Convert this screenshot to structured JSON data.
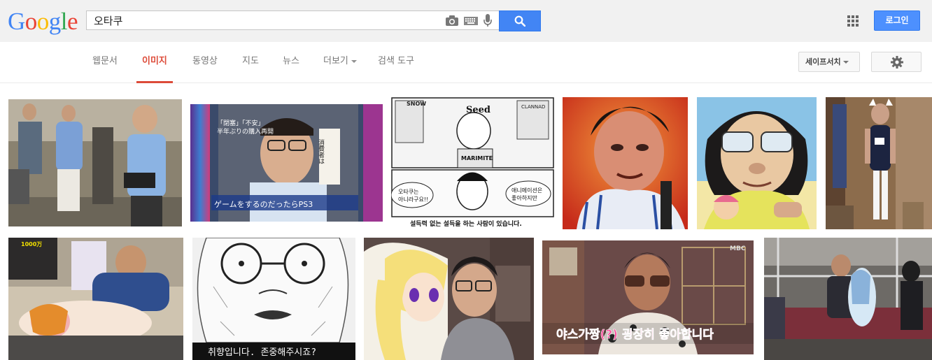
{
  "logo": [
    "G",
    "o",
    "o",
    "g",
    "l",
    "e"
  ],
  "logo_colors": [
    "#4285f4",
    "#ea4335",
    "#fbbc05",
    "#4285f4",
    "#34a853",
    "#ea4335"
  ],
  "search": {
    "value": "오타쿠"
  },
  "login_label": "로그인",
  "tabs": [
    {
      "label": "웹문서",
      "active": false
    },
    {
      "label": "이미지",
      "active": true
    },
    {
      "label": "동영상",
      "active": false
    },
    {
      "label": "지도",
      "active": false
    },
    {
      "label": "뉴스",
      "active": false
    },
    {
      "label": "더보기",
      "active": false,
      "dropdown": true
    },
    {
      "label": "검색 도구",
      "active": false
    }
  ],
  "safesearch_label": "세이프서치",
  "accent_color": "#dd4b39",
  "results": [
    {
      "id": "r1",
      "captions": []
    },
    {
      "id": "r2",
      "captions": [
        "「閉塞」「不安」",
        "半年ぶりの購入再開",
        "消費者は",
        "ゲームをするのだったらPS3"
      ]
    },
    {
      "id": "r3",
      "captions": [
        "SNOW",
        "Seed",
        "CLANNAD",
        "MARIMITE",
        "오타쿠는",
        "아니라구요!!",
        "애니메이션은",
        "좋아하지만",
        "설득력 없는 설득을 하는 사람이 있습니다."
      ]
    },
    {
      "id": "r4",
      "captions": []
    },
    {
      "id": "r5",
      "captions": []
    },
    {
      "id": "r6",
      "captions": []
    },
    {
      "id": "r7",
      "captions": [
        "1000万"
      ]
    },
    {
      "id": "r8",
      "captions": [
        "취향입니다. 존중해주시죠?"
      ]
    },
    {
      "id": "r9",
      "captions": []
    },
    {
      "id": "r10",
      "captions": [
        "MBC",
        "야스가짱(?) 굉장히 좋아합니다"
      ]
    },
    {
      "id": "r11",
      "captions": []
    }
  ]
}
